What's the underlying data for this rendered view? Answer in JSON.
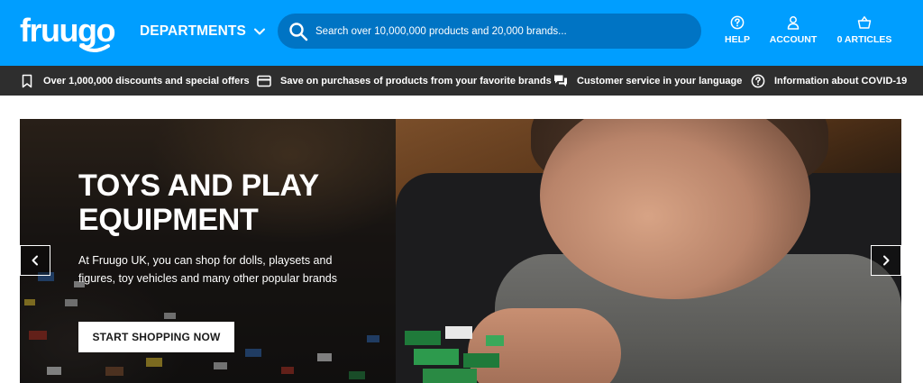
{
  "header": {
    "logo_text": "fruugo",
    "departments_label": "DEPARTMENTS",
    "search_placeholder": "Search over 10,000,000 products and 20,000 brands...",
    "help_label": "HELP",
    "account_label": "ACCOUNT",
    "articles_label": "0 ARTICLES",
    "brand_color": "#009eff"
  },
  "benefits": [
    {
      "icon": "bookmark-icon",
      "label": "Over 1,000,000 discounts and special offers"
    },
    {
      "icon": "credit-card-icon",
      "label": "Save on purchases of products from your favorite brands"
    },
    {
      "icon": "chat-icon",
      "label": "Customer service in your language"
    },
    {
      "icon": "question-circle-icon",
      "label": "Information about COVID-19"
    }
  ],
  "hero": {
    "title": "TOYS AND PLAY EQUIPMENT",
    "description": "At Fruugo UK, you can shop for dolls, playsets and figures, toy vehicles and many other popular brands",
    "cta_label": "START SHOPPING NOW",
    "prev_icon": "chevron-left-icon",
    "next_icon": "chevron-right-icon"
  }
}
